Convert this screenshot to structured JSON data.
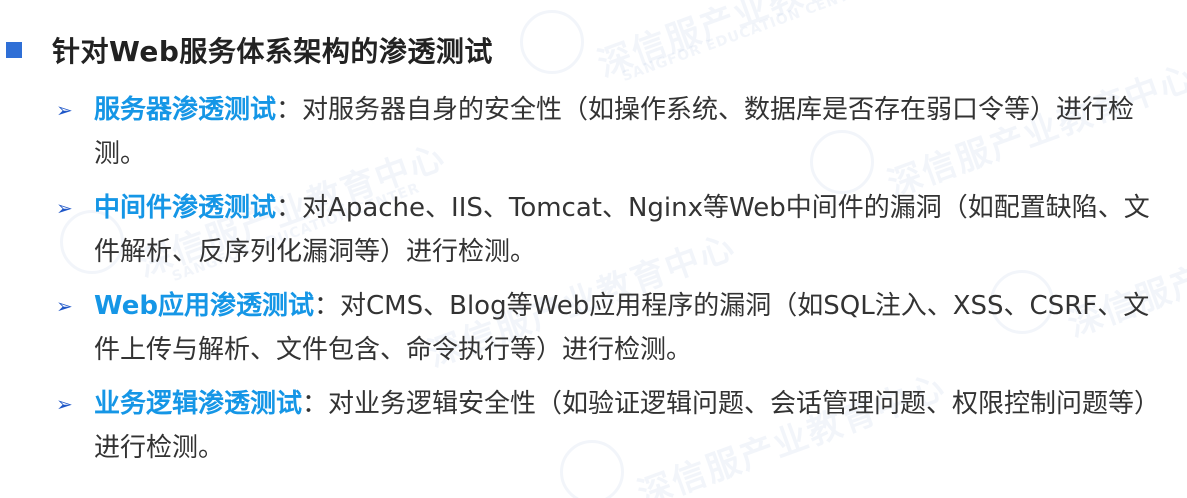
{
  "heading": {
    "title": "针对Web服务体系架构的渗透测试"
  },
  "items": [
    {
      "bullet": "➢",
      "term": "服务器渗透测试",
      "separator": "：",
      "description": "对服务器自身的安全性（如操作系统、数据库是否存在弱口令等）进行检测。"
    },
    {
      "bullet": "➢",
      "term": "中间件渗透测试",
      "separator": "：",
      "description": "对Apache、IIS、Tomcat、Nginx等Web中间件的漏洞（如配置缺陷、文件解析、反序列化漏洞等）进行检测。"
    },
    {
      "bullet": "➢",
      "term": "Web应用渗透测试",
      "separator": "：",
      "description": "对CMS、Blog等Web应用程序的漏洞（如SQL注入、XSS、CSRF、文件上传与解析、文件包含、命令执行等）进行检测。"
    },
    {
      "bullet": "➢",
      "term": "业务逻辑渗透测试",
      "separator": "：",
      "description": "对业务逻辑安全性（如验证逻辑问题、会话管理问题、权限控制问题等）进行检测。"
    }
  ],
  "watermark": {
    "main_text": "深信服产业教育中心",
    "sub_text": "SANGFOR EDUCATION CENTER"
  },
  "colors": {
    "heading_square": "#2f6fd6",
    "term": "#1596e6",
    "bullet": "#1f57c8",
    "body_text": "#333333"
  }
}
